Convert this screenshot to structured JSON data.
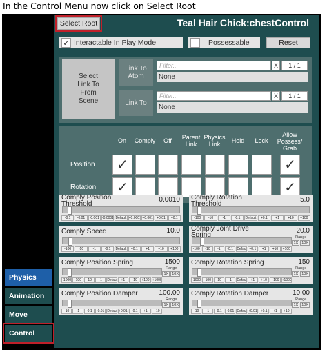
{
  "caption": "In the Control Menu now click on Select Root",
  "header": {
    "select_root": "Select Root",
    "title": "Teal Hair Chick:chestControl"
  },
  "options": {
    "interactable_label": "Interactable In Play Mode",
    "interactable_checked": "✓",
    "possessable_label": "Possessable",
    "reset": "Reset"
  },
  "link": {
    "select_button": "Select\nLink To\nFrom\nScene",
    "atom_label": "Link To\nAtom",
    "link_to_label": "Link To",
    "filter_placeholder": "Filter...",
    "x": "X",
    "page": "1 / 1",
    "none": "None"
  },
  "grid": {
    "columns": [
      "On",
      "Comply",
      "Off",
      "Parent\nLink",
      "Physics\nLink",
      "Hold",
      "Lock",
      "Allow\nPossess/\nGrab"
    ],
    "rows": [
      "Position",
      "Rotation"
    ],
    "check": "✓"
  },
  "sliders": [
    {
      "label": "Comply Position\nThreshold",
      "value": "0.0010",
      "steps": [
        "-0.1",
        "-0.01",
        "-0.001",
        "-0.0001",
        "Default",
        "+0.0001",
        "+0.001",
        "+0.01",
        "+0.1"
      ],
      "range": false
    },
    {
      "label": "Comply Rotation\nThreshold",
      "value": "5.0",
      "steps": [
        "-100",
        "-10",
        "-1",
        "-0.1",
        "Default",
        "+0.1",
        "+1",
        "+10",
        "+100"
      ],
      "range": false
    },
    {
      "label": "Comply Speed",
      "value": "10.0",
      "steps": [
        "-100",
        "-10",
        "-1",
        "-0.1",
        "Default",
        "+0.1",
        "+1",
        "+10",
        "+100"
      ],
      "range": false
    },
    {
      "label": "Comply Joint Drive\nSpring",
      "value": "20.0",
      "steps": [
        "-100",
        "-10",
        "-1",
        "-0.1",
        "Default",
        "+0.1",
        "+1",
        "+10",
        "+100"
      ],
      "range": true
    },
    {
      "label": "Comply Position Spring",
      "value": "1500",
      "steps": [
        "-1000",
        "-100",
        "-10",
        "-1",
        "Default",
        "+1",
        "+10",
        "+100",
        "+1000"
      ],
      "range": true
    },
    {
      "label": "Comply Rotation Spring",
      "value": "150",
      "steps": [
        "-1000",
        "-100",
        "-10",
        "-1",
        "Default",
        "+1",
        "+10",
        "+100",
        "+1000"
      ],
      "range": true
    },
    {
      "label": "Comply Position Damper",
      "value": "100.00",
      "steps": [
        "-10",
        "-1",
        "-0.1",
        "-0.01",
        "Default",
        "+0.01",
        "+0.1",
        "+1",
        "+10"
      ],
      "range": true
    },
    {
      "label": "Comply Rotation Damper",
      "value": "10.00",
      "steps": [
        "-10",
        "-1",
        "-0.1",
        "-0.01",
        "Default",
        "+0.01",
        "+0.1",
        "+1",
        "+10"
      ],
      "range": true
    }
  ],
  "range": {
    "label": "Range",
    "a": "1X",
    "b": "10X"
  },
  "sidebar": {
    "items": [
      {
        "label": "Physics",
        "color": "#1e5fa8"
      },
      {
        "label": "Animation",
        "color": "#1e4d4f"
      },
      {
        "label": "Move",
        "color": "#1e4d4f"
      },
      {
        "label": "Control",
        "color": "#1e4d4f"
      }
    ]
  }
}
